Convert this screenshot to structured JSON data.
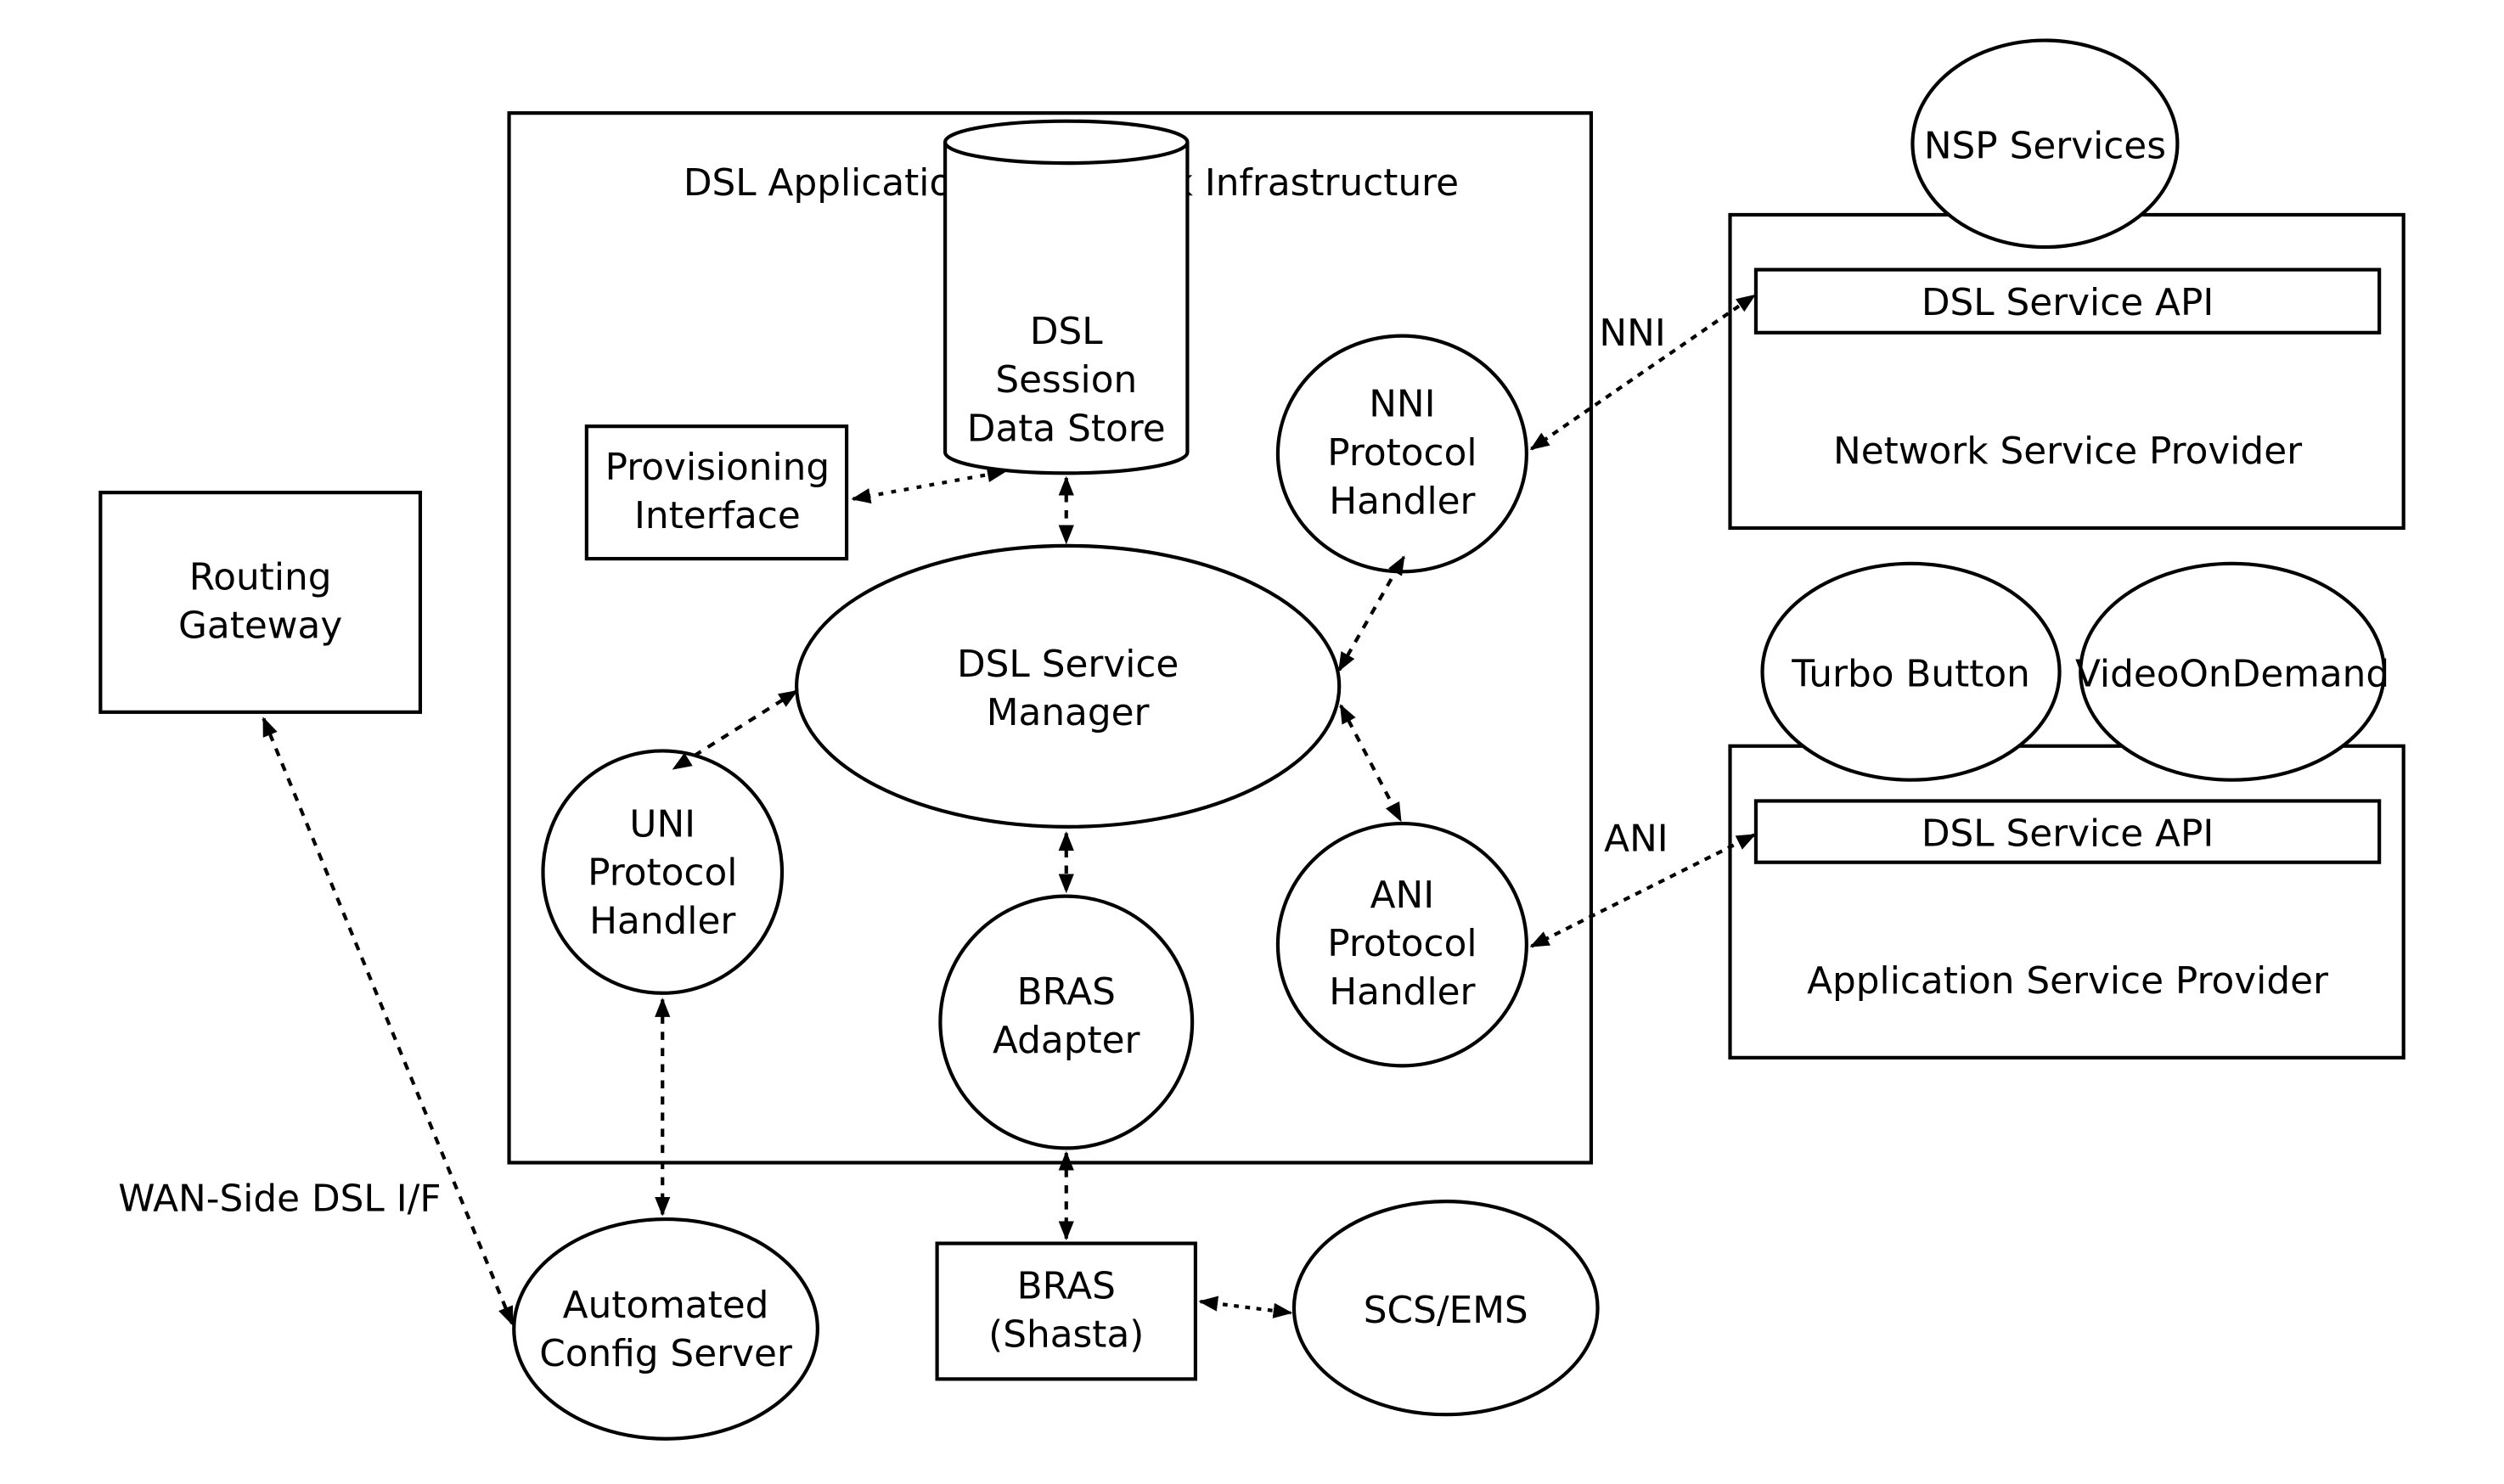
{
  "diagram": {
    "framework": {
      "title": "DSL Application Framework Infrastructure"
    },
    "nodes": {
      "session_store": {
        "lines": [
          "DSL",
          "Session",
          "Data Store"
        ]
      },
      "provisioning": {
        "lines": [
          "Provisioning",
          "Interface"
        ]
      },
      "nni_handler": {
        "lines": [
          "NNI",
          "Protocol",
          "Handler"
        ]
      },
      "service_manager": {
        "lines": [
          "DSL Service",
          "Manager"
        ]
      },
      "uni_handler": {
        "lines": [
          "UNI",
          "Protocol",
          "Handler"
        ]
      },
      "bras_adapter": {
        "lines": [
          "BRAS",
          "Adapter"
        ]
      },
      "ani_handler": {
        "lines": [
          "ANI",
          "Protocol",
          "Handler"
        ]
      },
      "routing_gateway": {
        "lines": [
          "Routing",
          "Gateway"
        ]
      },
      "config_server": {
        "lines": [
          "Automated",
          "Config Server"
        ]
      },
      "bras": {
        "lines": [
          "BRAS",
          "(Shasta)"
        ]
      },
      "scs_ems": {
        "lines": [
          "SCS/EMS"
        ]
      },
      "nsp_services": {
        "lines": [
          "NSP Services"
        ]
      },
      "nsp": {
        "api": "DSL Service API",
        "label": "Network Service Provider"
      },
      "turbo_button": {
        "lines": [
          "Turbo Button"
        ]
      },
      "video_on_demand": {
        "lines": [
          "VideoOnDemand"
        ]
      },
      "asp": {
        "api": "DSL Service API",
        "label": "Application Service Provider"
      }
    },
    "edge_labels": {
      "nni": "NNI",
      "ani": "ANI",
      "wan": "WAN-Side DSL I/F"
    },
    "edges": [
      {
        "from": "provisioning",
        "to": "session_store",
        "style": "dotted",
        "arrows": "both"
      },
      {
        "from": "session_store",
        "to": "service_manager",
        "style": "dashed",
        "arrows": "both"
      },
      {
        "from": "service_manager",
        "to": "nni_handler",
        "style": "dashed",
        "arrows": "both"
      },
      {
        "from": "service_manager",
        "to": "uni_handler",
        "style": "dashed",
        "arrows": "both"
      },
      {
        "from": "service_manager",
        "to": "bras_adapter",
        "style": "dashed",
        "arrows": "both"
      },
      {
        "from": "service_manager",
        "to": "ani_handler",
        "style": "dashed",
        "arrows": "both"
      },
      {
        "from": "nni_handler",
        "to": "nsp",
        "style": "dotted",
        "arrows": "both",
        "label": "NNI"
      },
      {
        "from": "ani_handler",
        "to": "asp",
        "style": "dotted",
        "arrows": "both",
        "label": "ANI"
      },
      {
        "from": "uni_handler",
        "to": "config_server",
        "style": "dashed",
        "arrows": "both"
      },
      {
        "from": "bras_adapter",
        "to": "bras",
        "style": "dashed",
        "arrows": "both"
      },
      {
        "from": "bras",
        "to": "scs_ems",
        "style": "dotted",
        "arrows": "both"
      },
      {
        "from": "routing_gateway",
        "to": "config_server",
        "style": "dashed",
        "arrows": "both",
        "label": "WAN-Side DSL I/F"
      }
    ]
  }
}
